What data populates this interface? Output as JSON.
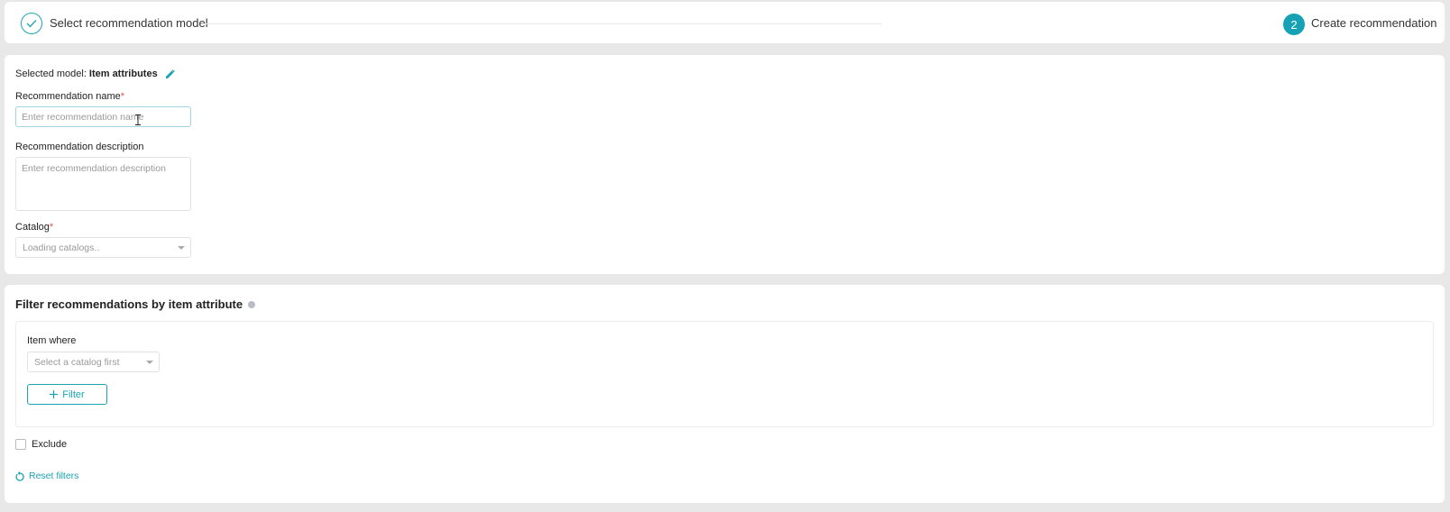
{
  "stepper": {
    "step1_label": "Select recommendation model",
    "step2_number": "2",
    "step2_label": "Create recommendation"
  },
  "form": {
    "selected_model_prefix": "Selected model:",
    "selected_model_value": "Item attributes",
    "name_label": "Recommendation name",
    "name_required": "*",
    "name_placeholder": "Enter recommendation name",
    "description_label": "Recommendation description",
    "description_placeholder": "Enter recommendation description",
    "catalog_label": "Catalog",
    "catalog_required": "*",
    "catalog_value": "Loading catalogs.."
  },
  "filter": {
    "title": "Filter recommendations by item attribute",
    "item_where_label": "Item where",
    "catalog_select_value": "Select a catalog first",
    "add_filter_label": "Filter",
    "exclude_label": "Exclude",
    "reset_label": "Reset filters"
  },
  "colors": {
    "accent": "#16a1b5",
    "required": "#d9534f"
  }
}
